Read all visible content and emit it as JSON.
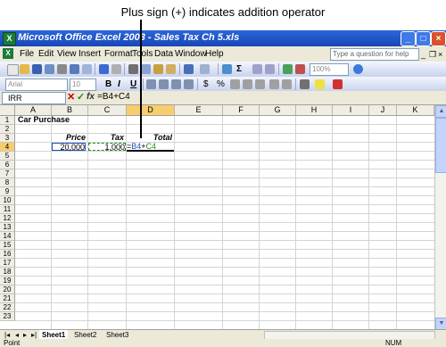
{
  "callout": {
    "text": "Plus sign (+) indicates addition operator"
  },
  "window": {
    "app_icon": "X",
    "title": "Microsoft Office Excel 2003 - Sales Tax Ch 5.xls",
    "minimize": "_",
    "maximize": "□",
    "close": "×"
  },
  "menu": {
    "items": [
      "File",
      "Edit",
      "View",
      "Insert",
      "Format",
      "Tools",
      "Data",
      "Window",
      "Help"
    ],
    "help_placeholder": "Type a question for help",
    "doc_min": "_",
    "doc_restore": "❐",
    "doc_close": "×"
  },
  "toolbar": {
    "zoom": "100%",
    "font": "Arial",
    "size": "10",
    "bold": "B",
    "italic": "I",
    "underline": "U",
    "currency": "$",
    "percent": "%",
    "sum": "Σ"
  },
  "formula_bar": {
    "name_box": "IRR",
    "cancel": "✕",
    "enter": "✓",
    "fx": "fx",
    "formula": "=B4+C4"
  },
  "grid": {
    "columns": [
      "A",
      "B",
      "C",
      "D",
      "E",
      "F",
      "G",
      "H",
      "I",
      "J",
      "K"
    ],
    "active_column": "D",
    "rows": [
      "1",
      "2",
      "3",
      "4",
      "5",
      "6",
      "7",
      "8",
      "9",
      "10",
      "11",
      "12",
      "13",
      "14",
      "15",
      "16",
      "17",
      "18",
      "19",
      "20",
      "21",
      "22",
      "23"
    ],
    "active_row": "4",
    "cells": {
      "a1": "Car Purchase",
      "b3": "Price",
      "c3": "Tax",
      "d3": "Total",
      "b4": "20,000",
      "c4": "1,000",
      "d4_prefix": "=",
      "d4_ref1": "B4",
      "d4_op": "+",
      "d4_ref2": "C4"
    }
  },
  "sheets": {
    "nav": [
      "|◂",
      "◂",
      "▸",
      "▸|"
    ],
    "tabs": [
      "Sheet1",
      "Sheet2",
      "Sheet3"
    ],
    "active": "Sheet1"
  },
  "status": {
    "mode": "Point",
    "num": "NUM"
  },
  "colors": {
    "title_bar": "#1846b8",
    "active_header": "#f8cd6e",
    "ref1": "#1f4fbf",
    "ref2": "#1a8f1a"
  }
}
